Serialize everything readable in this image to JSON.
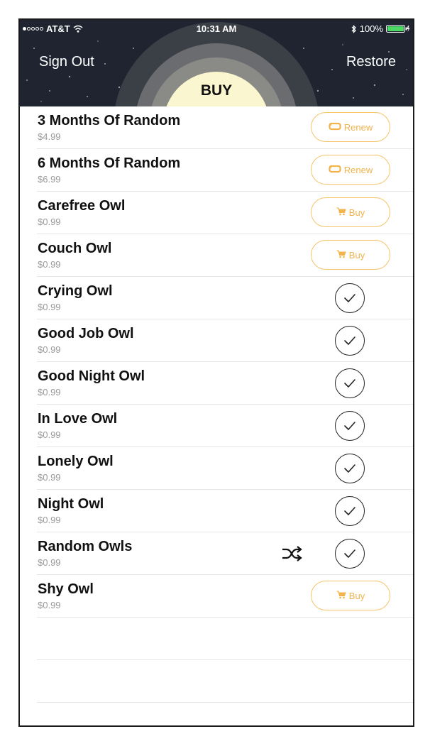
{
  "status_bar": {
    "carrier": "AT&T",
    "time": "10:31 AM",
    "battery": "100%",
    "icons": [
      "signal-dots-icon",
      "wifi-icon",
      "bluetooth-icon",
      "battery-icon"
    ]
  },
  "header": {
    "title": "BUY",
    "sign_out_label": "Sign Out",
    "restore_label": "Restore"
  },
  "colors": {
    "header_bg": "#1f2430",
    "accent_orange": "#f1b34a",
    "moon": "#faf6cf"
  },
  "items": [
    {
      "name": "3 Months Of Random",
      "price": "$4.99",
      "action": "renew",
      "action_label": "Renew"
    },
    {
      "name": "6 Months Of Random",
      "price": "$6.99",
      "action": "renew",
      "action_label": "Renew"
    },
    {
      "name": "Carefree Owl",
      "price": "$0.99",
      "action": "buy",
      "action_label": "Buy"
    },
    {
      "name": "Couch Owl",
      "price": "$0.99",
      "action": "buy",
      "action_label": "Buy"
    },
    {
      "name": "Crying Owl",
      "price": "$0.99",
      "action": "owned"
    },
    {
      "name": "Good Job Owl",
      "price": "$0.99",
      "action": "owned"
    },
    {
      "name": "Good Night Owl",
      "price": "$0.99",
      "action": "owned"
    },
    {
      "name": "In Love Owl",
      "price": "$0.99",
      "action": "owned"
    },
    {
      "name": "Lonely Owl",
      "price": "$0.99",
      "action": "owned"
    },
    {
      "name": "Night Owl",
      "price": "$0.99",
      "action": "owned"
    },
    {
      "name": "Random Owls",
      "price": "$0.99",
      "action": "owned",
      "shuffle": true
    },
    {
      "name": "Shy Owl",
      "price": "$0.99",
      "action": "buy",
      "action_label": "Buy"
    }
  ]
}
